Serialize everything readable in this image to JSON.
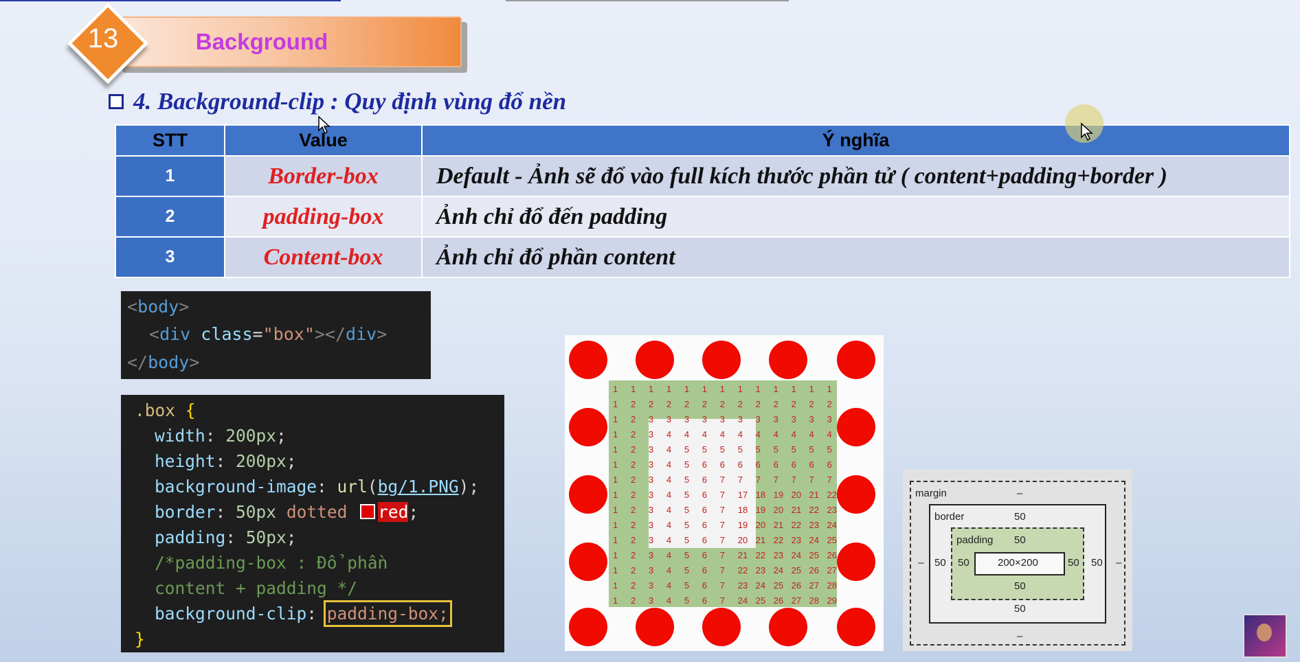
{
  "header": {
    "lesson_number": "13",
    "title": "Background"
  },
  "heading": {
    "text": "4. Background-clip : Quy định vùng đổ nền"
  },
  "table": {
    "headers": [
      "STT",
      "Value",
      "Ý nghĩa"
    ],
    "rows": [
      {
        "stt": "1",
        "value": "Border-box",
        "meaning": "Default - Ảnh sẽ đổ vào full kích thước phần tử ( content+padding+border )"
      },
      {
        "stt": "2",
        "value": "padding-box",
        "meaning": "Ảnh chỉ đổ đến padding"
      },
      {
        "stt": "3",
        "value": "Content-box",
        "meaning": "Ảnh chỉ đổ phần content"
      }
    ]
  },
  "html_code": {
    "line1_open": "<",
    "line1_tag": "body",
    "line1_close": ">",
    "line2_open": "<",
    "line2_tag": "div",
    "line2_attr": "class",
    "line2_eq": "=",
    "line2_val": "\"box\"",
    "line2_mid": "></",
    "line2_tag2": "div",
    "line2_close": ">",
    "line3_open": "</",
    "line3_tag": "body",
    "line3_close": ">"
  },
  "css_code": {
    "selector": ".box",
    "open_brace": "{",
    "l1_prop": "width",
    "l1_val": "200px",
    "l2_prop": "height",
    "l2_val": "200px",
    "l3_prop": "background-image",
    "l3_fn": "url",
    "l3_arg": "bg/1.PNG",
    "l4_prop": "border",
    "l4_val1": "50px",
    "l4_val2": "dotted",
    "l4_color": "red",
    "l5_prop": "padding",
    "l5_val": "50px",
    "cmt1": "/*padding-box : Đổ phần",
    "cmt2": "content + padding */",
    "l6_prop": "background-clip",
    "l6_val": "padding-box;",
    "close_brace": "}"
  },
  "box_model": {
    "margin_label": "margin",
    "margin_top": "–",
    "margin_bottom": "–",
    "margin_left": "–",
    "margin_right": "–",
    "border_label": "border",
    "border_top": "50",
    "border_bottom": "50",
    "border_left": "50",
    "border_right": "50",
    "padding_label": "padding",
    "padding_top": "50",
    "padding_bottom": "50",
    "padding_left": "50",
    "padding_right": "50",
    "content": "200×200"
  },
  "colors": {
    "accent_blue": "#3f74c8",
    "header_orange": "#f08a2c",
    "title_magenta": "#c43be0",
    "value_red": "#e02020"
  }
}
